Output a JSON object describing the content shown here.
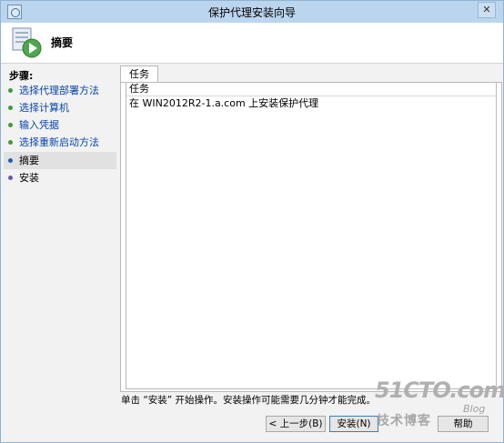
{
  "window": {
    "title": "保护代理安装向导",
    "close_label": "✕"
  },
  "header": {
    "title": "摘要"
  },
  "steps": {
    "heading": "步骤:",
    "items": [
      {
        "label": "选择代理部署方法",
        "state": "done"
      },
      {
        "label": "选择计算机",
        "state": "done"
      },
      {
        "label": "输入凭据",
        "state": "done"
      },
      {
        "label": "选择重新启动方法",
        "state": "done"
      },
      {
        "label": "摘要",
        "state": "current"
      },
      {
        "label": "安装",
        "state": "pending"
      }
    ]
  },
  "tab": {
    "label": "任务"
  },
  "task_list": {
    "column_header": "任务",
    "rows": [
      "在 WIN2012R2-1.a.com 上安装保护代理"
    ]
  },
  "status_text": "单击 “安装” 开始操作。安装操作可能需要几分钟才能完成。",
  "buttons": {
    "back": "< 上一步(B)",
    "install": "安装(N)",
    "help": "帮助"
  },
  "watermark": {
    "main": "51CTO.com",
    "sub": "技术博客",
    "blog": "Blog"
  },
  "colors": {
    "titlebar": "#bcd5ee",
    "done_dot": "#3c9a3c",
    "current_dot": "#1e5fb4",
    "pending_dot": "#6a56b9",
    "link": "#0645ad"
  }
}
